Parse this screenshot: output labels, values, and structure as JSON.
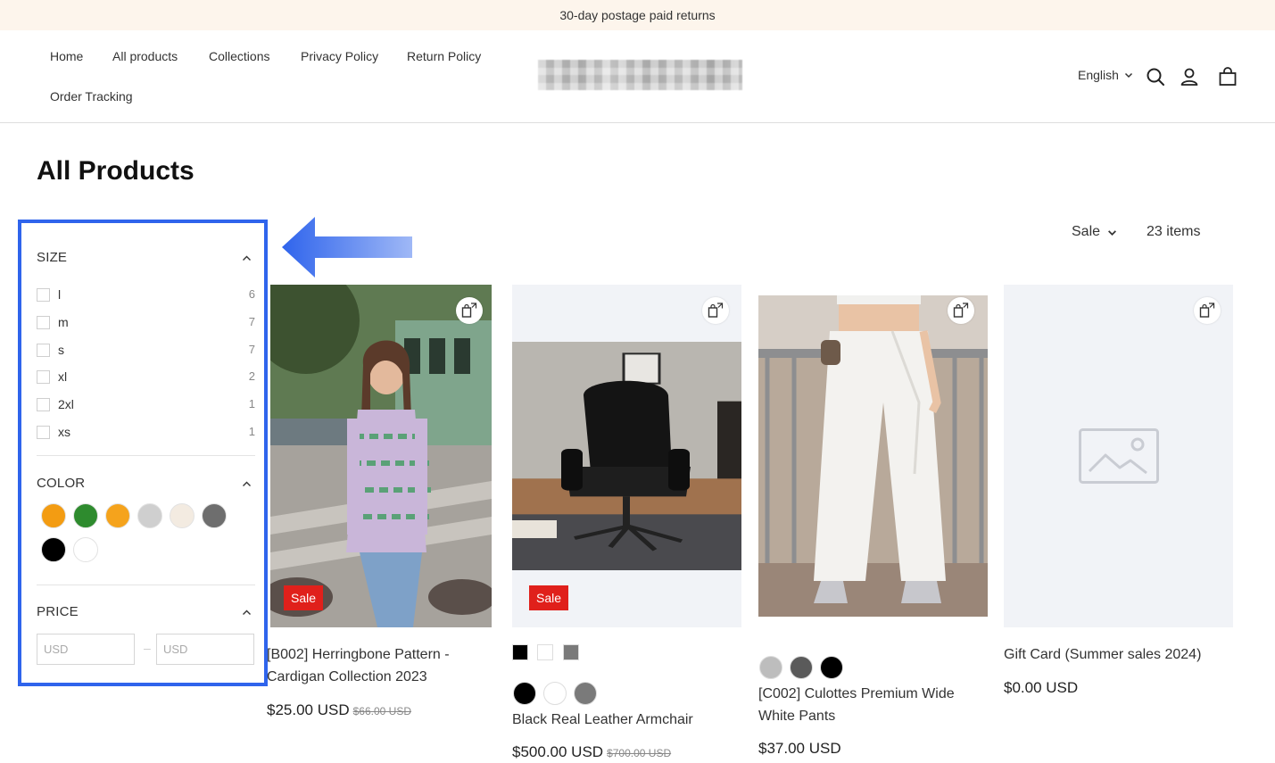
{
  "announcement": "30-day postage paid returns",
  "nav": {
    "home": "Home",
    "all_products": "All products",
    "collections": "Collections",
    "privacy_policy": "Privacy Policy",
    "return_policy": "Return Policy",
    "order_tracking": "Order Tracking"
  },
  "header": {
    "language": "English",
    "icons": [
      "search-icon",
      "account-icon",
      "cart-icon"
    ]
  },
  "page_title": "All Products",
  "filters": {
    "size": {
      "heading": "SIZE",
      "options": [
        {
          "label": "l",
          "count": "6"
        },
        {
          "label": "m",
          "count": "7"
        },
        {
          "label": "s",
          "count": "7"
        },
        {
          "label": "xl",
          "count": "2"
        },
        {
          "label": "2xl",
          "count": "1"
        },
        {
          "label": "xs",
          "count": "1"
        }
      ]
    },
    "color": {
      "heading": "COLOR",
      "swatches": [
        "#f39c12",
        "#2e8b2e",
        "#f5a31c",
        "#cfcfcf",
        "#f3ebe1",
        "#6e6e6e",
        "#000000",
        "#ffffff"
      ]
    },
    "price": {
      "heading": "PRICE",
      "from_placeholder": "USD",
      "to_placeholder": "USD",
      "separator": "–"
    }
  },
  "toolbar": {
    "sort_label": "Sale",
    "item_count": "23 items"
  },
  "products": [
    {
      "title": "[B002] Herringbone Pattern - Cardigan Collection 2023",
      "price": "$25.00 USD",
      "compare_price": "$66.00 USD",
      "badge": "Sale"
    },
    {
      "title": "Black Real Leather Armchair",
      "price": "$500.00 USD",
      "compare_price": "$700.00 USD",
      "badge": "Sale",
      "square_swatches": [
        "#000000",
        "#ffffff",
        "#7a7a7a"
      ],
      "round_swatches": [
        "#000000",
        "#ffffff",
        "#7a7a7a"
      ]
    },
    {
      "title": "[C002] Culottes Premium Wide White Pants",
      "price": "$37.00 USD",
      "round_swatches": [
        "#bdbdbd",
        "#5a5a5a",
        "#000000"
      ]
    },
    {
      "title": "Gift Card (Summer sales 2024)",
      "price": "$0.00 USD"
    }
  ],
  "colors": {
    "accent_outline": "#2f64ec",
    "sale_badge": "#e0201b",
    "announcement_bg": "#fdf5ec"
  }
}
